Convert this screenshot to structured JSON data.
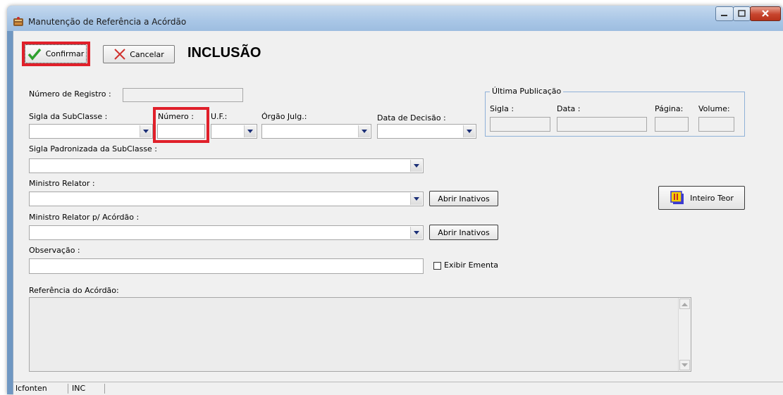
{
  "window": {
    "title": "Manutenção de Referência a Acórdão"
  },
  "toolbar": {
    "confirm_label": "Confirmar",
    "cancel_label": "Cancelar",
    "mode": "INCLUSÃO"
  },
  "form": {
    "numero_registro_label": "Número de Registro :",
    "sigla_subclasse_label": "Sigla da SubClasse :",
    "numero_label": "Número :",
    "uf_label": "U.F.:",
    "orgao_julg_label": "Órgão Julg.:",
    "data_decisao_label": "Data de Decisão :",
    "sigla_padronizada_label": "Sigla Padronizada da SubClasse :",
    "ministro_relator_label": "Ministro Relator :",
    "abrir_inativos_label": "Abrir Inativos",
    "ministro_relator_acordao_label": "Ministro Relator p/ Acórdão :",
    "observacao_label": "Observação :",
    "exibir_ementa_label": "Exibir Ementa",
    "referencia_label": "Referência do Acórdão:",
    "inteiro_teor_label": "Inteiro Teor"
  },
  "ultima_publicacao": {
    "title": "Última Publicação",
    "sigla_label": "Sigla :",
    "data_label": "Data :",
    "pagina_label": "Página:",
    "volume_label": "Volume:"
  },
  "status": {
    "cell1": "lcfonten",
    "cell2": "INC"
  },
  "colors": {
    "highlight": "#e0202a",
    "titlebar": "#a9c6e6",
    "group_border": "#8fb1d8"
  }
}
